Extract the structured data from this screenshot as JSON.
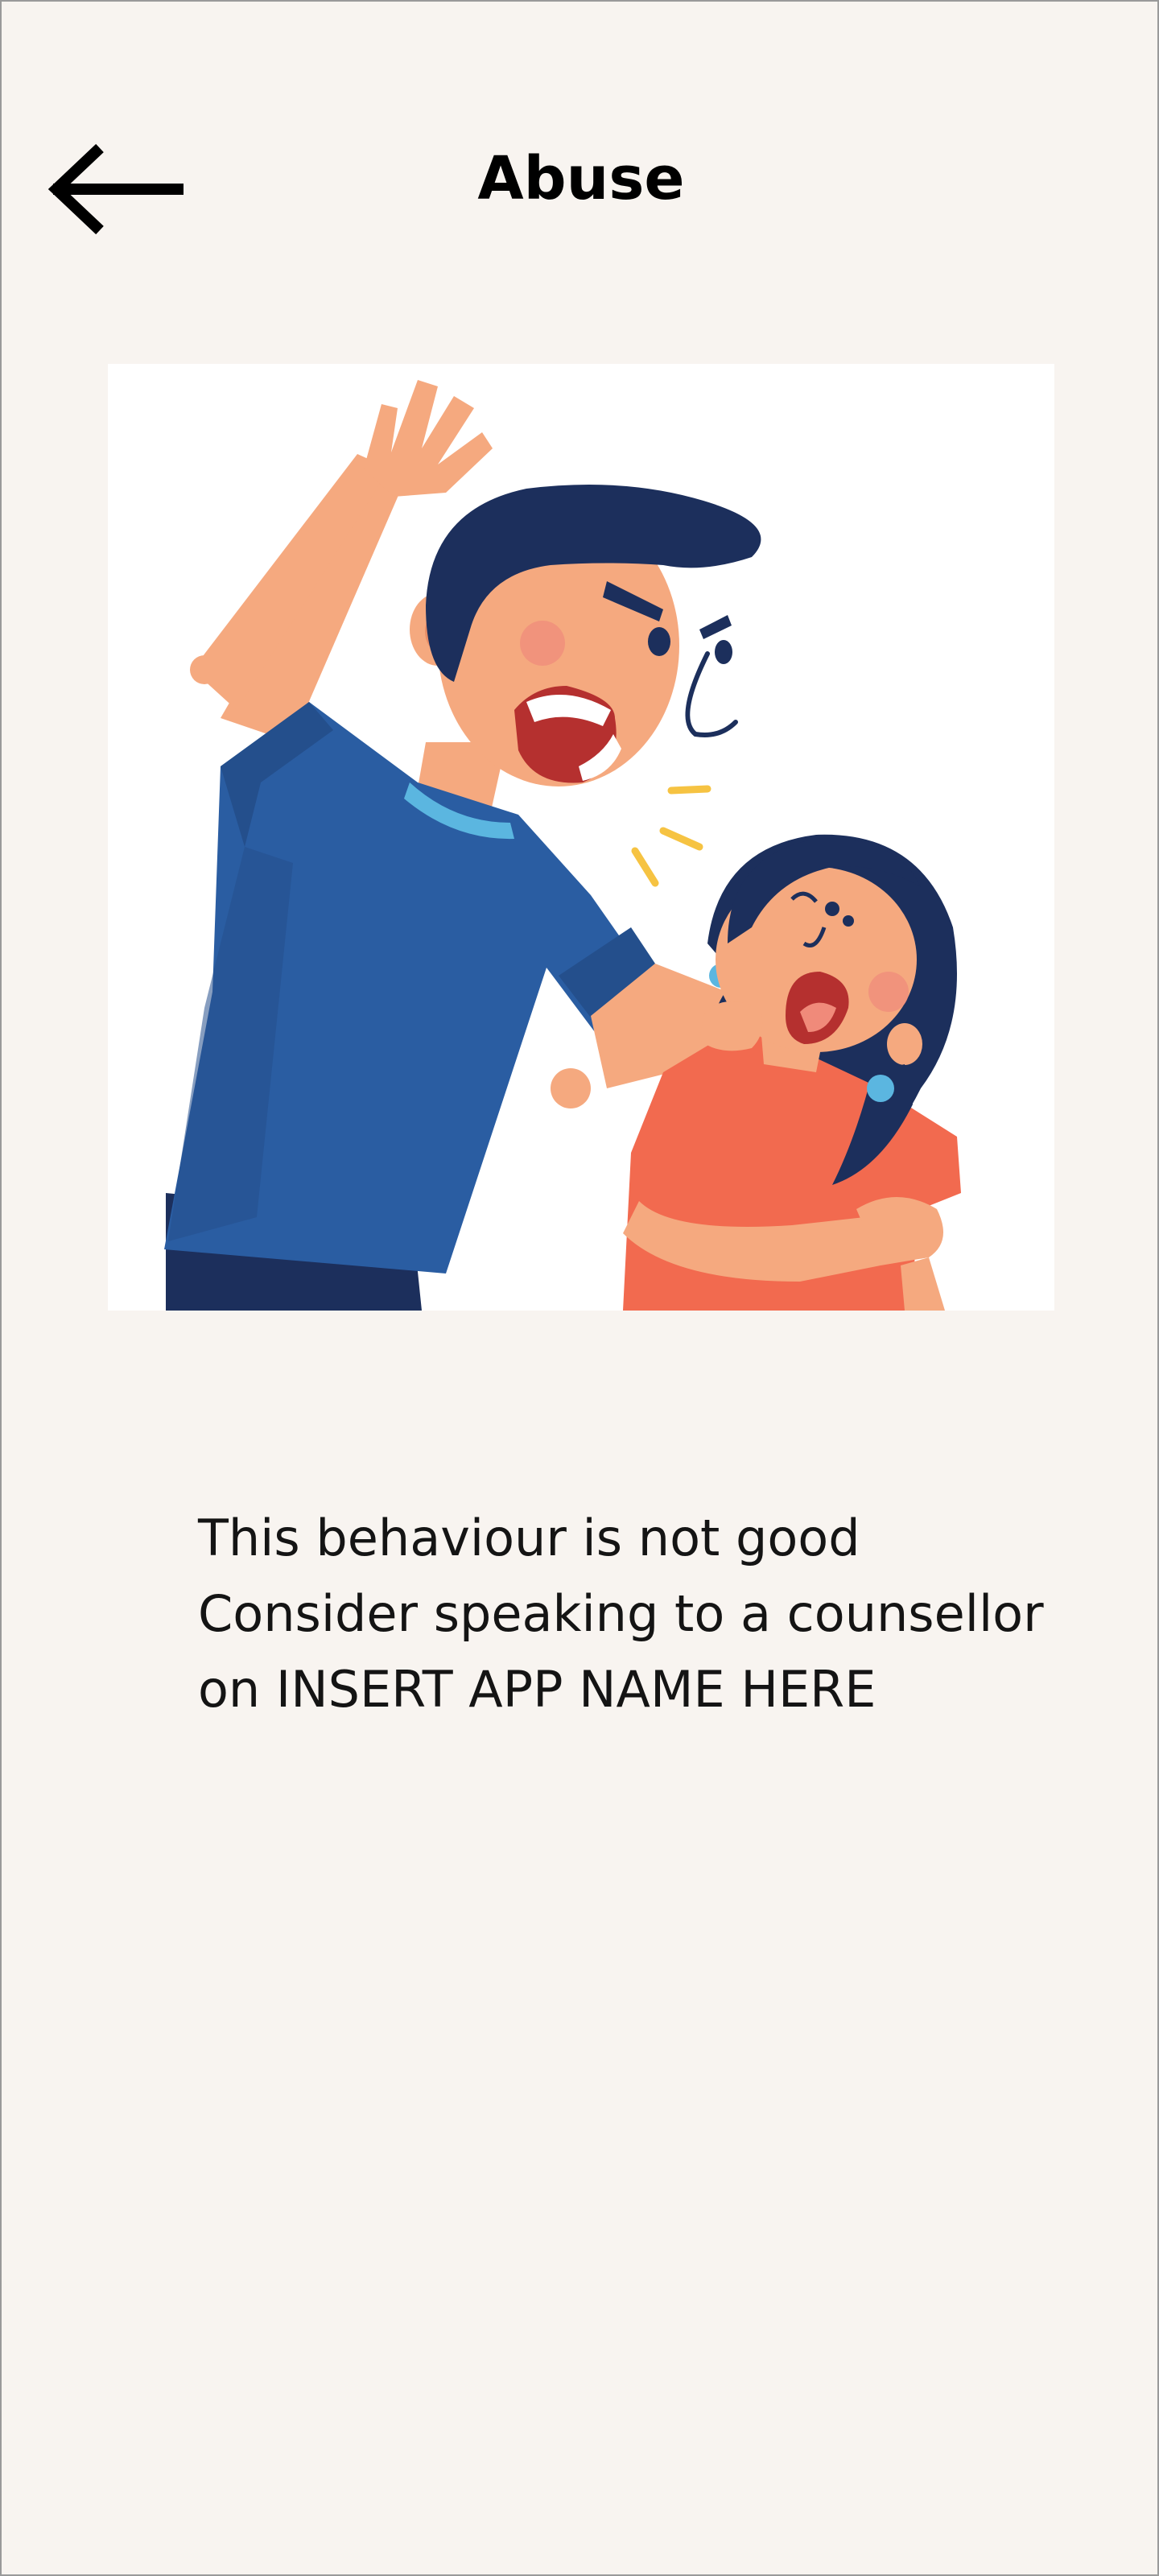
{
  "header": {
    "title": "Abuse",
    "back_icon": "arrow-left-icon"
  },
  "illustration": {
    "icon": "abuse-illustration"
  },
  "message": {
    "line1": "This behaviour is not good",
    "line2": "Consider speaking to a counsellor",
    "line3": "on INSERT APP NAME HERE"
  },
  "colors": {
    "background": "#f8f4f0",
    "text": "#141414",
    "shirt_blue": "#2a5da2",
    "hair_navy": "#1c2f5c",
    "skin": "#f5a97f",
    "girl_shirt": "#f26a4f"
  }
}
